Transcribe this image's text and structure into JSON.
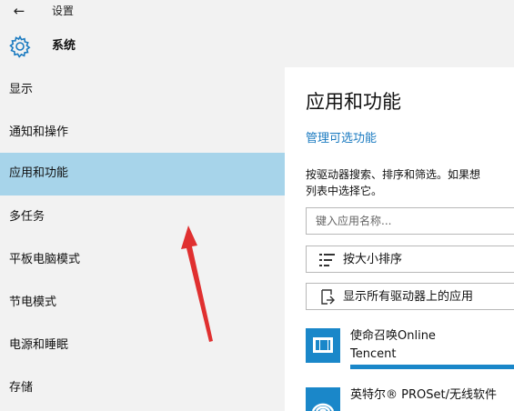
{
  "window": {
    "title": "设置",
    "section_title": "系统",
    "back_icon": "back-arrow-icon",
    "section_icon": "gear-icon"
  },
  "sidebar": {
    "items": [
      {
        "label": "显示",
        "active": false
      },
      {
        "label": "通知和操作",
        "active": false
      },
      {
        "label": "应用和功能",
        "active": true
      },
      {
        "label": "多任务",
        "active": false
      },
      {
        "label": "平板电脑模式",
        "active": false
      },
      {
        "label": "节电模式",
        "active": false
      },
      {
        "label": "电源和睡眠",
        "active": false
      },
      {
        "label": "存储",
        "active": false
      }
    ]
  },
  "main": {
    "title": "应用和功能",
    "manage_link": "管理可选功能",
    "description_line1": "按驱动器搜索、排序和筛选。如果想",
    "description_line2": "列表中选择它。",
    "search_placeholder": "键入应用名称...",
    "sort_button": "按大小排序",
    "drive_button": "显示所有驱动器上的应用",
    "apps": [
      {
        "name": "使命召唤Online",
        "publisher": "Tencent"
      },
      {
        "name": "英特尔® PROSet/无线软件",
        "publisher": ""
      }
    ]
  },
  "colors": {
    "accent": "#1a87c9",
    "link": "#1a7ac0",
    "selection": "#a7d4ea",
    "sidebar_bg": "#f2f2f2",
    "annotation_arrow": "#e03030"
  }
}
